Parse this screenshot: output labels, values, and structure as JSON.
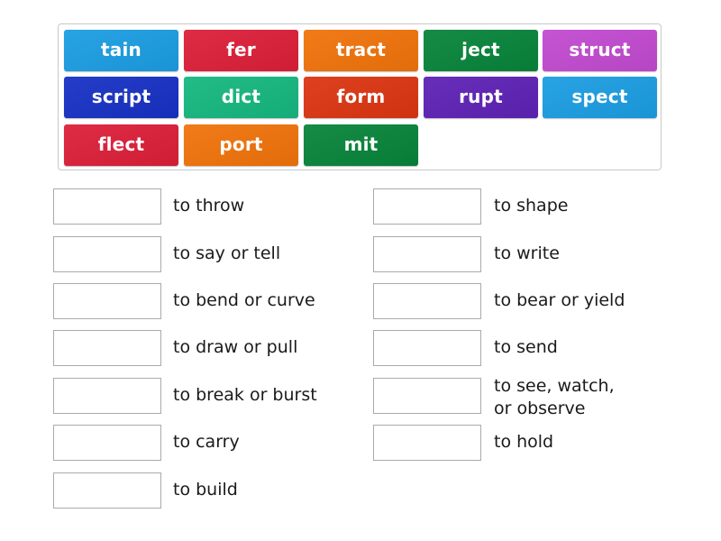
{
  "tiles": [
    {
      "label": "tain",
      "color": "#1b9de2"
    },
    {
      "label": "fer",
      "color": "#dc1f39"
    },
    {
      "label": "tract",
      "color": "#f0730a"
    },
    {
      "label": "ject",
      "color": "#07843a"
    },
    {
      "label": "struct",
      "color": "#c24ad0"
    },
    {
      "label": "script",
      "color": "#1731c4"
    },
    {
      "label": "dict",
      "color": "#15b77f"
    },
    {
      "label": "form",
      "color": "#dc3511"
    },
    {
      "label": "rupt",
      "color": "#5e22b5"
    },
    {
      "label": "spect",
      "color": "#1b9de2"
    },
    {
      "label": "flect",
      "color": "#dc1f39"
    },
    {
      "label": "port",
      "color": "#f0730a"
    },
    {
      "label": "mit",
      "color": "#07843a"
    }
  ],
  "left_column": [
    {
      "definition": "to throw"
    },
    {
      "definition": "to say or tell"
    },
    {
      "definition": "to bend or curve"
    },
    {
      "definition": "to draw or pull"
    },
    {
      "definition": "to break or burst"
    },
    {
      "definition": "to carry"
    },
    {
      "definition": "to build"
    }
  ],
  "right_column": [
    {
      "definition": "to shape"
    },
    {
      "definition": "to write"
    },
    {
      "definition": "to bear or yield"
    },
    {
      "definition": "to send"
    },
    {
      "definition": "to see, watch,\nor observe"
    },
    {
      "definition": "to hold"
    }
  ]
}
